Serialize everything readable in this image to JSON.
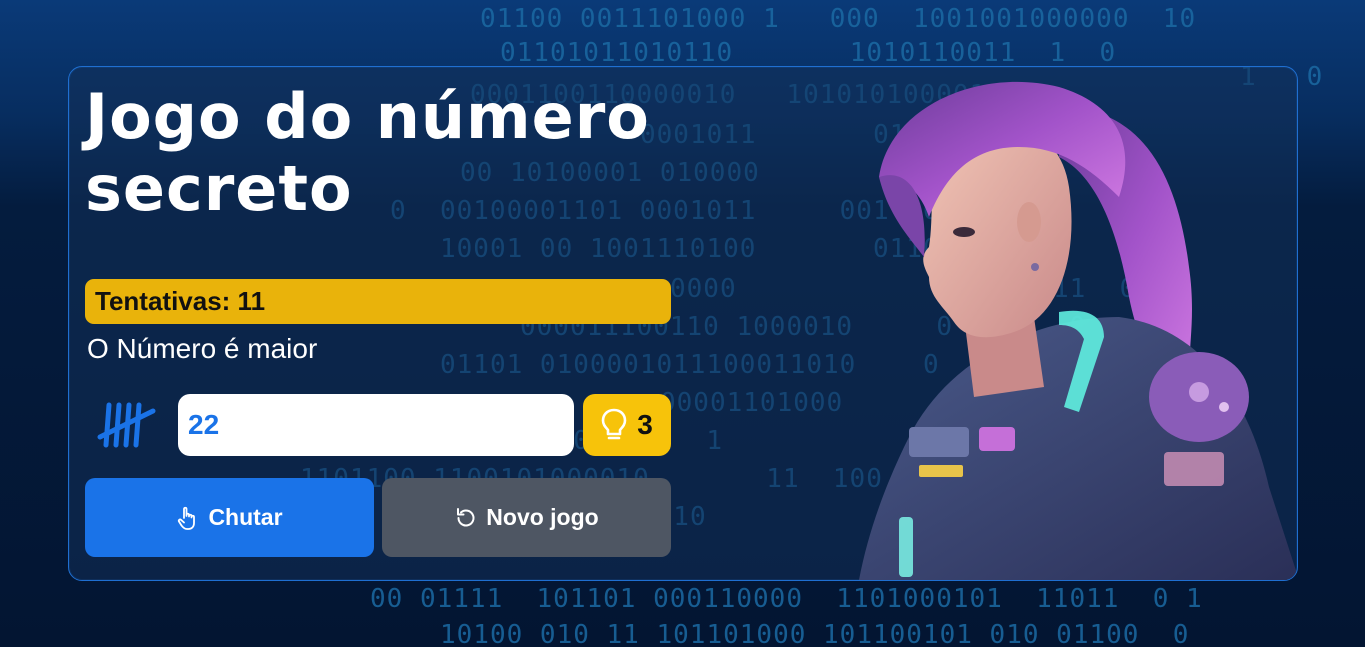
{
  "game": {
    "title": "Jogo do número secreto",
    "attempts_label": "Tentativas: 11",
    "message": "O Número é maior",
    "guess_value": "22",
    "hints_count": "3",
    "kick_button_label": "Chutar",
    "new_game_button_label": "Novo jogo"
  },
  "icons": {
    "tally": "tally-marks-icon",
    "hint": "lightbulb-icon",
    "kick": "pointing-hand-icon",
    "new_game": "restart-icon"
  },
  "colors": {
    "accent_blue": "#1a73e8",
    "attempts_yellow": "#e9b30b",
    "hint_yellow": "#f7c30a",
    "secondary_gray": "#4e5663",
    "background_navy": "#041c3e"
  }
}
